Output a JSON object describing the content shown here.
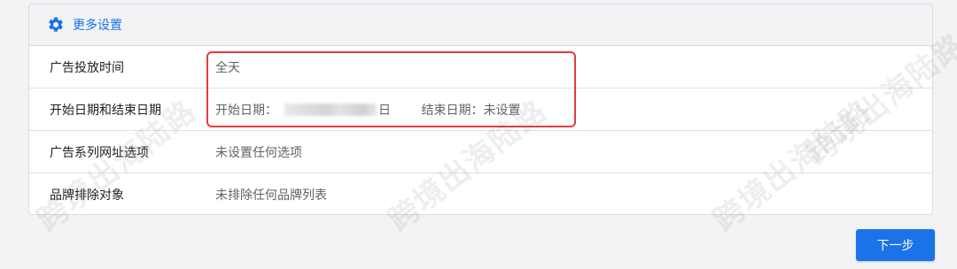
{
  "header": {
    "title": "更多设置",
    "icon": "gear-icon"
  },
  "rows": [
    {
      "label": "广告投放时间",
      "value": "全天"
    },
    {
      "label": "开始日期和结束日期",
      "start_label": "开始日期：",
      "start_value_suffix": "日",
      "end_label": "结束日期：",
      "end_value": "未设置"
    },
    {
      "label": "广告系列网址选项",
      "value": "未设置任何选项"
    },
    {
      "label": "品牌排除对象",
      "value": "未排除任何品牌列表"
    }
  ],
  "next_button": "下一步",
  "watermark": "跨境出海陆路",
  "colors": {
    "accent": "#1a73e8",
    "highlight": "#e33b3b"
  }
}
